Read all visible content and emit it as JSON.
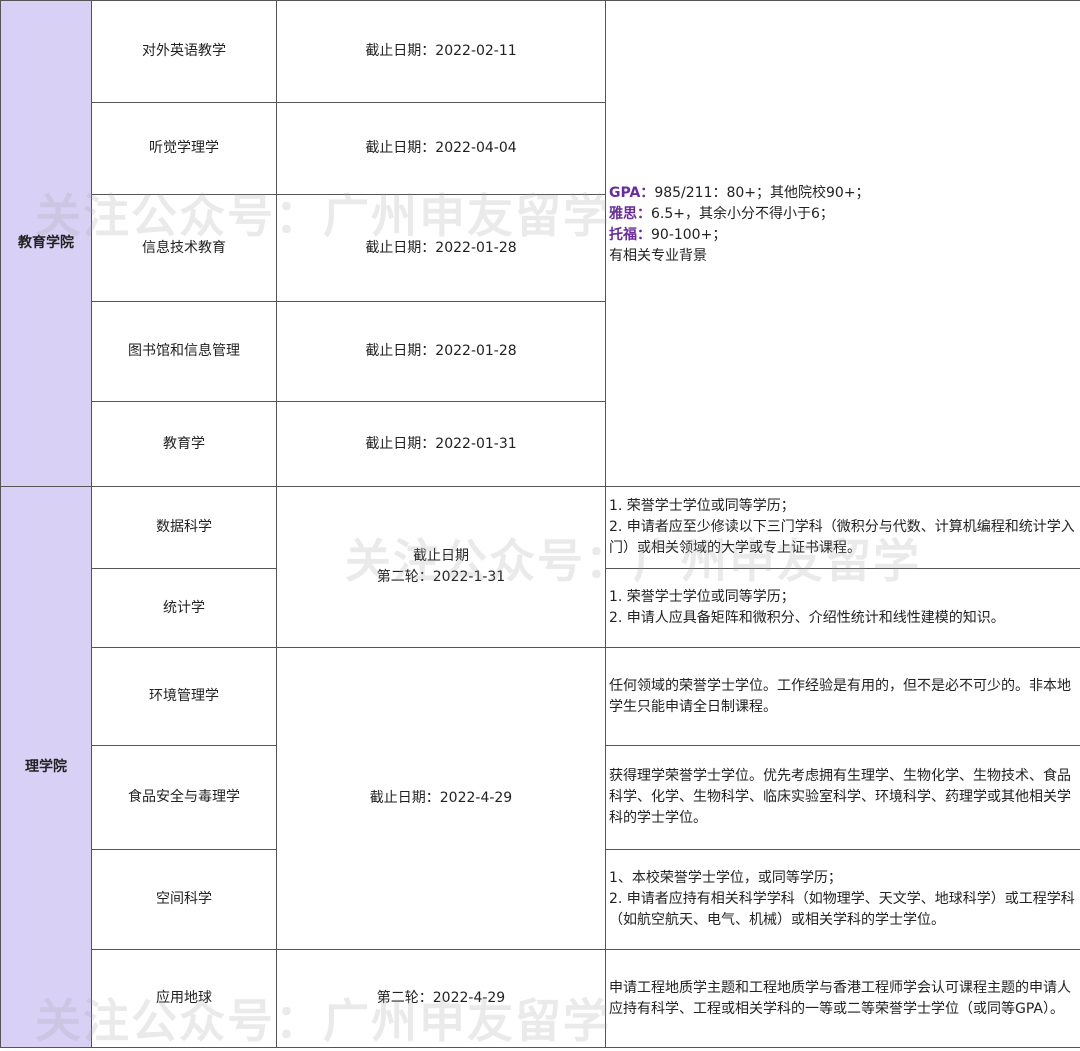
{
  "edu": {
    "college": "教育学院",
    "programs": [
      {
        "name": "对外英语教学",
        "deadline": "截止日期：2022-02-11"
      },
      {
        "name": "听觉学理学",
        "deadline": "截止日期：2022-04-04"
      },
      {
        "name": "信息技术教育",
        "deadline": "截止日期：2022-01-28"
      },
      {
        "name": "图书馆和信息管理",
        "deadline": "截止日期：2022-01-28"
      },
      {
        "name": "教育学",
        "deadline": "截止日期：2022-01-31"
      }
    ],
    "req": {
      "gpa_label": "GPA：",
      "gpa_text": "985/211：80+；其他院校90+；",
      "ielts_label": "雅思：",
      "ielts_text": "6.5+，其余小分不得小于6；",
      "toefl_label": "托福：",
      "toefl_text": "90-100+；",
      "note": "有相关专业背景"
    }
  },
  "sci": {
    "college": "理学院",
    "programs": [
      {
        "name": "数据科学"
      },
      {
        "name": "统计学"
      },
      {
        "name": "环境管理学"
      },
      {
        "name": "食品安全与毒理学"
      },
      {
        "name": "空间科学"
      },
      {
        "name": "应用地球"
      }
    ],
    "deadline_group1": {
      "line1": "截止日期",
      "line2": "第二轮：2022-1-31"
    },
    "deadline_group2": "截止日期：2022-4-29",
    "deadline_group3": "第二轮：2022-4-29",
    "reqs": {
      "data_science": [
        "1. 荣誉学士学位或同等学历；",
        "2. 申请者应至少修读以下三门学科（微积分与代数、计算机编程和统计学入门）或相关领域的大学或专上证书课程。"
      ],
      "statistics": [
        "1. 荣誉学士学位或同等学历；",
        "2. 申请人应具备矩阵和微积分、介绍性统计和线性建模的知识。"
      ],
      "environment": "任何领域的荣誉学士学位。工作经验是有用的，但不是必不可少的。非本地学生只能申请全日制课程。",
      "food_safety": "获得理学荣誉学士学位。优先考虑拥有生理学、生物化学、生物技术、食品科学、化学、生物科学、临床实验室科学、环境科学、药理学或其他相关学科的学士学位。",
      "space_science": [
        "1、本校荣誉学士学位，或同等学历；",
        "2. 申请者应持有相关科学学科（如物理学、天文学、地球科学）或工程学科（如航空航天、电气、机械）或相关学科的学士学位。"
      ],
      "applied_geo": "申请工程地质学主题和工程地质学与香港工程师学会认可课程主题的申请人应持有科学、工程或相关学科的一等或二等荣誉学士学位（或同等GPA）。"
    }
  },
  "watermark": "关注公众号：广州申友留学"
}
